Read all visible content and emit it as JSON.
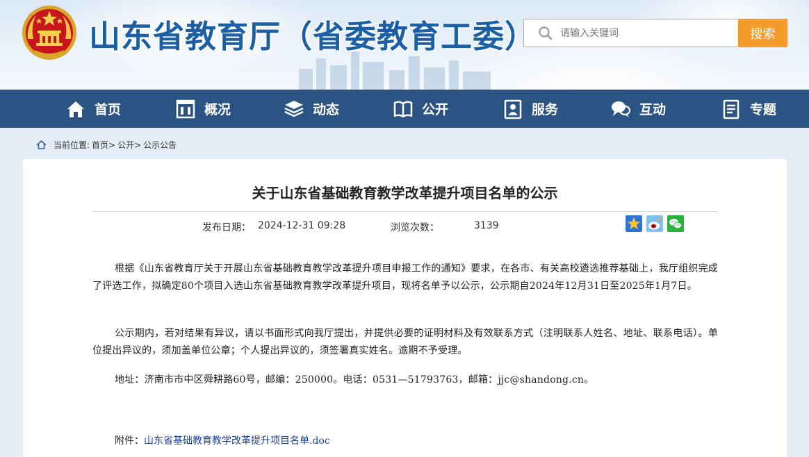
{
  "header": {
    "site_title": "山东省教育厅（省委教育工委）",
    "search_placeholder": "请输入关键词",
    "search_button": "搜索"
  },
  "nav": {
    "items": [
      {
        "label": "首页",
        "icon": "home-icon"
      },
      {
        "label": "概况",
        "icon": "building-icon"
      },
      {
        "label": "动态",
        "icon": "stack-icon"
      },
      {
        "label": "公开",
        "icon": "book-icon"
      },
      {
        "label": "服务",
        "icon": "service-icon"
      },
      {
        "label": "互动",
        "icon": "chat-icon"
      },
      {
        "label": "专题",
        "icon": "document-icon"
      }
    ]
  },
  "breadcrumb": {
    "prefix": "当前位置:",
    "items": [
      "首页>",
      "公开>",
      "公示公告"
    ]
  },
  "article": {
    "title": "关于山东省基础教育教学改革提升项目名单的公示",
    "publish_label": "发布日期：",
    "publish_date": "2024-12-31 09:28",
    "views_label": "浏览次数：",
    "views_count": "3139",
    "paragraphs": [
      "根据《山东省教育厅关于开展山东省基础教育教学改革提升项目申报工作的通知》要求，在各市、有关高校遴选推荐基础上，我厅组织完成了评选工作，拟确定80个项目入选山东省基础教育教学改革提升项目，现将名单予以公示，公示期自2024年12月31日至2025年1月7日。",
      "公示期内，若对结果有异议，请以书面形式向我厅提出，并提供必要的证明材料及有效联系方式（注明联系人姓名、地址、联系电话）。单位提出异议的，须加盖单位公章；个人提出异议的，须签署真实姓名。逾期不予受理。",
      "地址：济南市市中区舜耕路60号，邮编：250000。电话：0531—51793763，邮箱：jjc@shandong.cn。"
    ],
    "attachment_label": "附件：",
    "attachment_link": "山东省基础教育教学改革提升项目名单.doc"
  },
  "colors": {
    "brand_blue": "#1d5fa5",
    "nav_bg": "#2b5383",
    "search_orange": "#f39c2c",
    "page_bg": "#e4edf6"
  }
}
